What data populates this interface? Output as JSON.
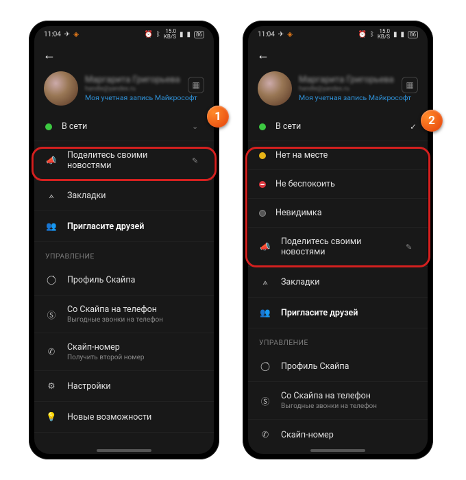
{
  "status": {
    "time": "11:04",
    "battery": "86",
    "net": "15.0",
    "net_unit": "KB/S"
  },
  "profile": {
    "name": "Маргарита Григорьева",
    "email": "handle@yandex.ru",
    "account_link": "Моя учетная запись Майкрософт"
  },
  "status_options": {
    "online": {
      "label": "В сети"
    },
    "away": {
      "label": "Нет на месте"
    },
    "dnd": {
      "label": "Не беспокоить"
    },
    "invisible": {
      "label": "Невидимка"
    }
  },
  "menu": {
    "share": "Поделитесь своими новостями",
    "bookmarks": "Закладки",
    "invite": "Пригласите друзей",
    "manage": "УПРАВЛЕНИЕ",
    "skype_profile": "Профиль Скайпа",
    "skype_phone": "Со Скайпа на телефон",
    "skype_phone_sub": "Выгодные звонки на телефон",
    "skype_number": "Скайп-номер",
    "skype_number_sub": "Получить второй номер",
    "settings": "Настройки",
    "whatsnew": "Новые возможности"
  },
  "callouts": {
    "one": "1",
    "two": "2"
  }
}
